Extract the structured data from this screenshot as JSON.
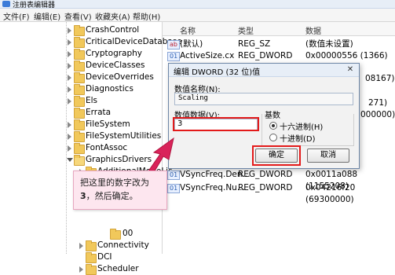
{
  "window": {
    "title": "注册表编辑器"
  },
  "menu": [
    "文件(F)",
    "编辑(E)",
    "查看(V)",
    "收藏夹(A)",
    "帮助(H)"
  ],
  "tree": {
    "items": [
      "CrashControl",
      "CriticalDeviceDatabase",
      "Cryptography",
      "DeviceClasses",
      "DeviceOverrides",
      "Diagnostics",
      "Els",
      "Errata",
      "FileSystem",
      "FileSystemUtilities",
      "FontAssoc",
      "GraphicsDrivers",
      "AdditionalModeLis",
      "00",
      "Connectivity",
      "DCI",
      "Scheduler"
    ]
  },
  "list": {
    "headers": [
      "名称",
      "类型",
      "数据"
    ],
    "rows": [
      {
        "name": "(默认)",
        "type": "REG_SZ",
        "data": "(数值未设置)",
        "kind": "string"
      },
      {
        "name": "ActiveSize.cx",
        "type": "REG_DWORD",
        "data": "0x00000556 (1366)",
        "kind": "binary"
      },
      {
        "name": "",
        "type": "",
        "data": "08167)",
        "kind": "binary"
      },
      {
        "name": "",
        "type": "",
        "data": "271)",
        "kind": "binary"
      },
      {
        "name": "",
        "type": "",
        "data": "000000)",
        "kind": "binary"
      },
      {
        "name": "VSyncFreq.Den...",
        "type": "REG_DWORD",
        "data": "0x0011a088 (1155208)",
        "kind": "binary"
      },
      {
        "name": "VSyncFreq.Nu...",
        "type": "REG_DWORD",
        "data": "0x04216f20 (69300000)",
        "kind": "binary"
      }
    ]
  },
  "dialog": {
    "title": "编辑 DWORD (32 位)值",
    "close_glyph": "✕",
    "value_name_label": "数值名称(N):",
    "value_name": "Scaling",
    "value_data_label": "数值数据(V):",
    "value_data": "3",
    "base_label": "基数",
    "base_options": [
      "十六进制(H)",
      "十进制(D)"
    ],
    "ok_label": "确定",
    "cancel_label": "取消"
  },
  "annotation": {
    "prefix": "把这里的数字改为",
    "number": "3",
    "suffix": "，然后确定。"
  },
  "colors": {
    "highlight_red": "#e31a1a",
    "note_bg": "#fde6ef"
  }
}
